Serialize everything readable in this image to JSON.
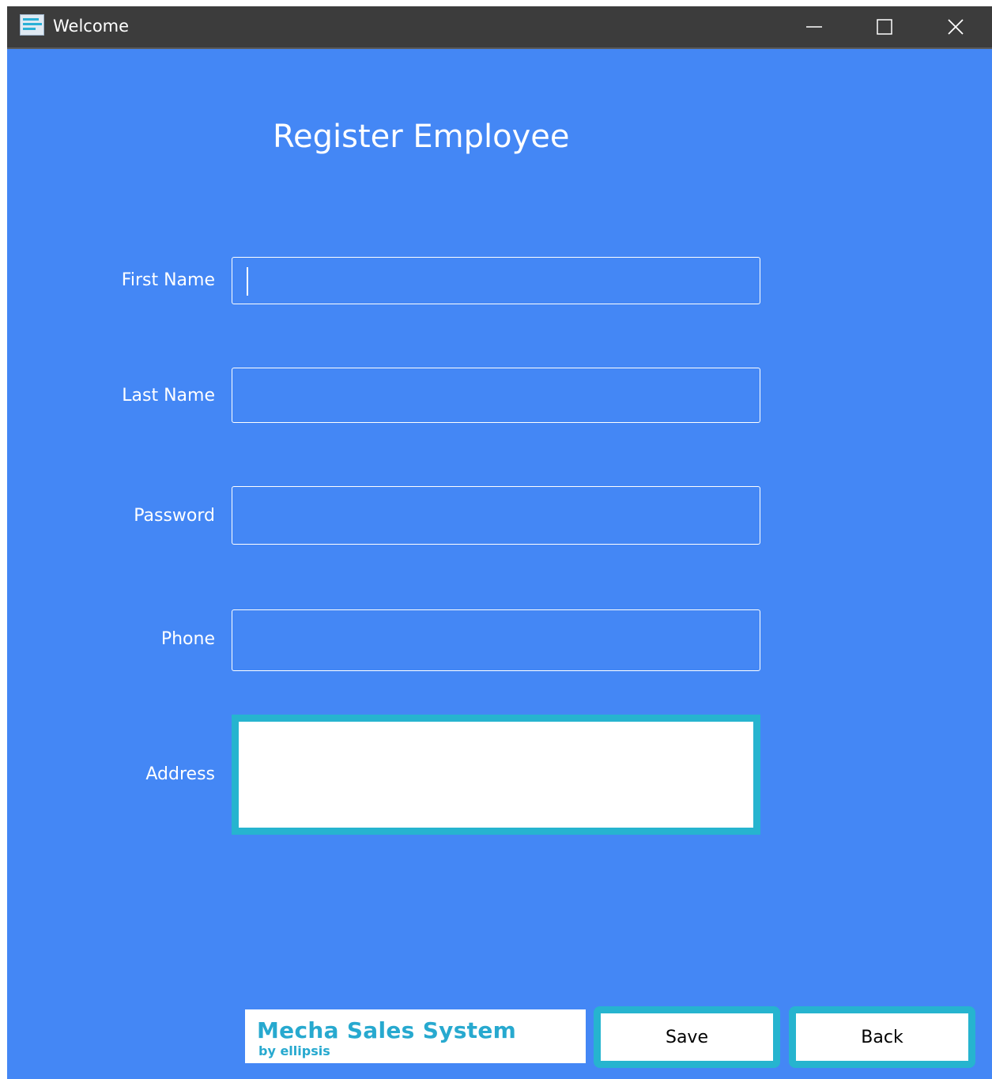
{
  "window": {
    "title": "Welcome",
    "icon": "app-icon",
    "controls": [
      "minimize-icon",
      "maximize-icon",
      "close-icon"
    ]
  },
  "form": {
    "heading": "Register Employee",
    "fields": [
      {
        "label": "First Name",
        "value": ""
      },
      {
        "label": "Last Name",
        "value": ""
      },
      {
        "label": "Password",
        "value": ""
      },
      {
        "label": "Phone",
        "value": ""
      },
      {
        "label": "Address",
        "value": ""
      }
    ]
  },
  "logo": {
    "title": "Mecha Sales System",
    "subtitle": "by ellipsis"
  },
  "actions": {
    "save_label": "Save",
    "back_label": "Back"
  },
  "colors": {
    "background": "#4487f5",
    "titlebar": "#3c3c3c",
    "accent": "#26b4cf",
    "text": "#ffffff"
  }
}
